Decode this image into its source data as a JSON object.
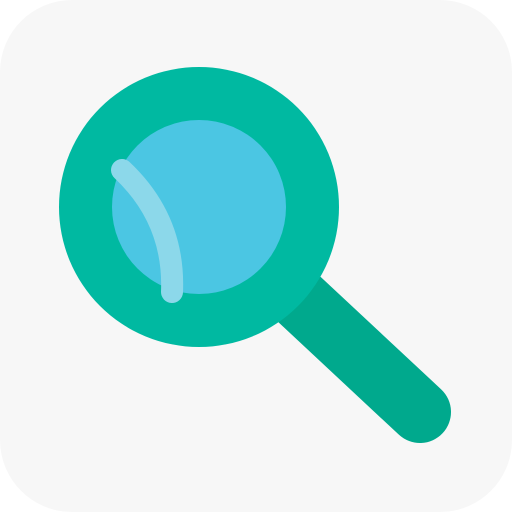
{
  "icon": {
    "name": "search-icon",
    "colors": {
      "tile_background": "#f7f7f7",
      "ring": "#00b9a1",
      "handle": "#00a98d",
      "lens": "#4bc6e3",
      "lens_highlight": "#8cd8ea"
    }
  }
}
